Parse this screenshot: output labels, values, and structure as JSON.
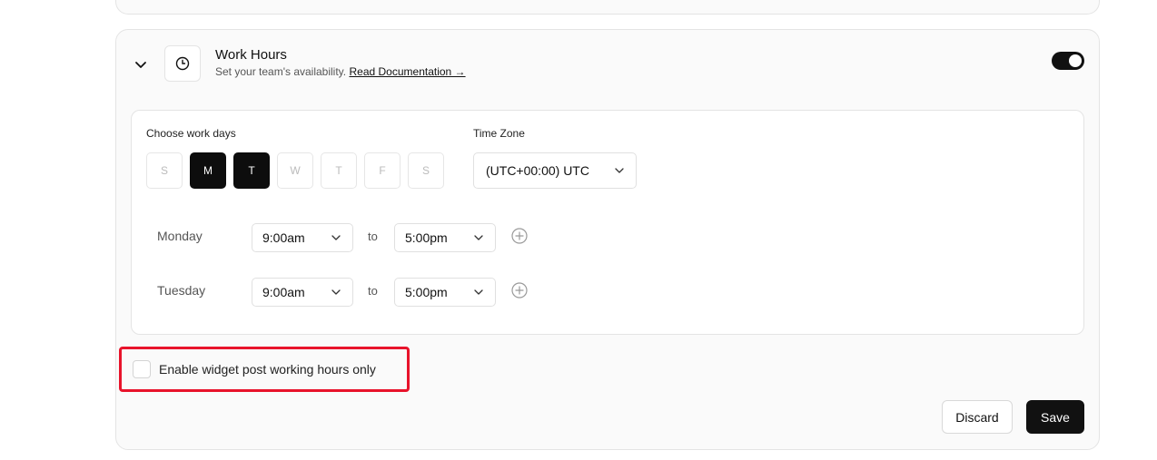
{
  "section": {
    "title": "Work Hours",
    "subtitle": "Set your team's availability.",
    "doc_link": "Read Documentation →",
    "enabled": true
  },
  "workdays": {
    "label": "Choose work days",
    "days": [
      {
        "label": "S",
        "active": false
      },
      {
        "label": "M",
        "active": true
      },
      {
        "label": "T",
        "active": true
      },
      {
        "label": "W",
        "active": false
      },
      {
        "label": "T",
        "active": false
      },
      {
        "label": "F",
        "active": false
      },
      {
        "label": "S",
        "active": false
      }
    ]
  },
  "timezone": {
    "label": "Time Zone",
    "value": "(UTC+00:00) UTC"
  },
  "schedule": [
    {
      "day": "Monday",
      "start": "9:00am",
      "to": "to",
      "end": "5:00pm"
    },
    {
      "day": "Tuesday",
      "start": "9:00am",
      "to": "to",
      "end": "5:00pm"
    }
  ],
  "widget_option": {
    "label": "Enable widget post working hours only",
    "checked": false,
    "highlight_color": "#e8132b"
  },
  "actions": {
    "discard": "Discard",
    "save": "Save"
  },
  "colors": {
    "primary": "#111111",
    "border": "#e4e4e4"
  },
  "icons": [
    "chevron-down-icon",
    "clock-icon",
    "plus-circle-icon"
  ]
}
